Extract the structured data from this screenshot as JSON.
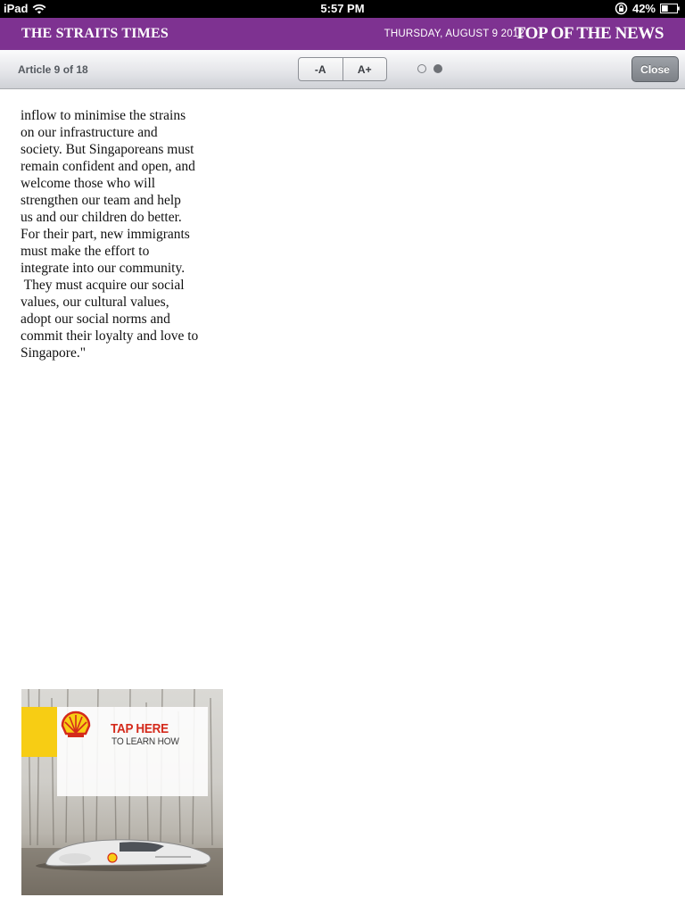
{
  "status_bar": {
    "device": "iPad",
    "time": "5:57 PM",
    "battery_percent": "42%",
    "battery_level": 0.42,
    "icons": [
      "wifi-icon",
      "rotation-lock-icon",
      "battery-icon"
    ]
  },
  "masthead": {
    "logo": "THE STRAITS TIMES",
    "date": "THURSDAY, AUGUST 9 2012",
    "section": "TOP OF THE NEWS",
    "background_color": "#7e3291"
  },
  "toolbar": {
    "article_counter": "Article 9 of 18",
    "decrease_font_label": "-A",
    "increase_font_label": "A+",
    "page_indicator": {
      "total_pages": 2,
      "current_page": 2
    },
    "close_label": "Close"
  },
  "article": {
    "lines": [
      "inflow to minimise the strains",
      "on our infrastructure and",
      "society. But Singaporeans must",
      "remain confident and open, and",
      "welcome those who will",
      "strengthen our team and help",
      "us and our children do better.",
      "For their part, new immigrants",
      "must make the effort to",
      "integrate into our community.",
      " They must acquire our social",
      "values, our cultural values,",
      "adopt our social norms and",
      "commit their loyalty and love to",
      "Singapore.\""
    ]
  },
  "advert": {
    "brand_icon": "shell-logo-icon",
    "headline": "TAP HERE",
    "subline": "TO LEARN HOW",
    "accent_color": "#d42a1b",
    "brand_yellow": "#f7cd14"
  }
}
